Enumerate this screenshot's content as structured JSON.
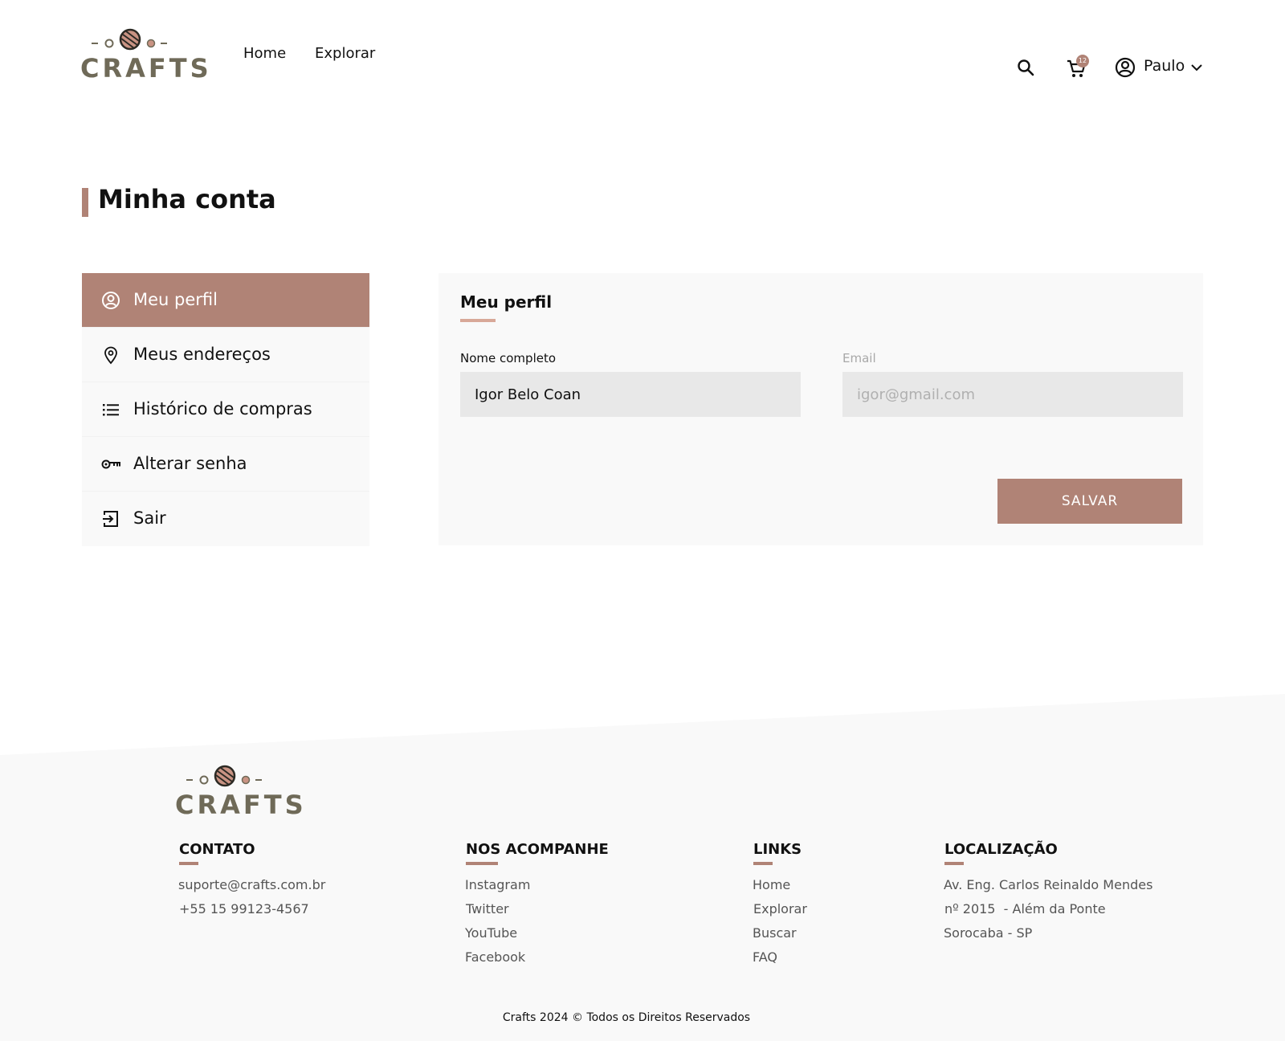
{
  "brand": {
    "name": "CRAFTS",
    "accent": "#b08376",
    "logo_text_color": "#6f6a58"
  },
  "header": {
    "nav": [
      {
        "label": "Home"
      },
      {
        "label": "Explorar"
      }
    ],
    "search_icon": "search-icon",
    "cart": {
      "icon": "cart-icon",
      "count": "12"
    },
    "user": {
      "icon": "user-circle-icon",
      "name": "Paulo",
      "dropdown_icon": "chevron-down-icon"
    }
  },
  "page": {
    "title": "Minha conta"
  },
  "sidebar": {
    "items": [
      {
        "label": "Meu perfil",
        "icon": "user-circle-icon",
        "active": true
      },
      {
        "label": "Meus endereços",
        "icon": "location-pin-icon",
        "active": false
      },
      {
        "label": "Histórico de compras",
        "icon": "list-icon",
        "active": false
      },
      {
        "label": "Alterar senha",
        "icon": "key-icon",
        "active": false
      },
      {
        "label": "Sair",
        "icon": "logout-icon",
        "active": false
      }
    ]
  },
  "profile": {
    "title": "Meu perfil",
    "name_label": "Nome completo",
    "name_value": "Igor Belo Coan",
    "email_label": "Email",
    "email_placeholder": "igor@gmail.com",
    "save_label": "SALVAR"
  },
  "footer": {
    "columns": [
      {
        "heading": "CONTATO",
        "items": [
          "suporte@crafts.com.br",
          "+55 15 99123-4567"
        ]
      },
      {
        "heading": "NOS ACOMPANHE",
        "items": [
          "Instagram",
          "Twitter",
          "YouTube",
          "Facebook"
        ]
      },
      {
        "heading": "LINKS",
        "items": [
          "Home",
          "Explorar",
          "Buscar",
          "FAQ"
        ]
      },
      {
        "heading": "LOCALIZAÇÃO",
        "items": [
          "Av. Eng. Carlos Reinaldo Mendes",
          "nº 2015  - Além da Ponte",
          "Sorocaba - SP"
        ]
      }
    ],
    "copyright": "Crafts 2024 © Todos os Direitos Reservados"
  }
}
